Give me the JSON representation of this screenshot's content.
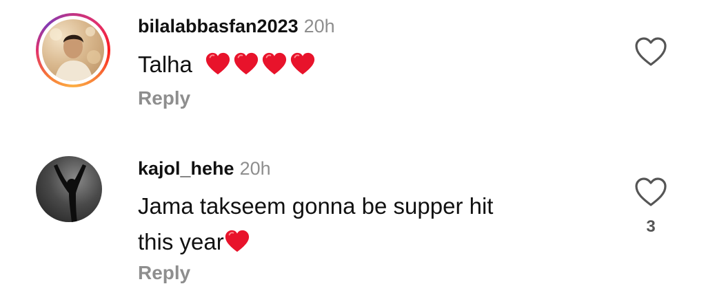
{
  "comments": [
    {
      "username": "bilalabbasfan2023",
      "time": "20h",
      "text": "Talha",
      "emoji_count": 4,
      "reply_label": "Reply",
      "like_count": "",
      "has_story_ring": true,
      "avatar_icon": "profile-photo"
    },
    {
      "username": "kajol_hehe",
      "time": "20h",
      "text_line1": "Jama takseem gonna be supper hit",
      "text_line2": "this year",
      "emoji_count": 1,
      "reply_label": "Reply",
      "like_count": "3",
      "has_story_ring": false,
      "avatar_icon": "silhouette-photo"
    }
  ],
  "colors": {
    "heart_emoji": "#e8132b",
    "secondary_text": "#8e8e8e",
    "primary_text": "#111111"
  },
  "icons": {
    "like": "heart-outline-icon",
    "emoji": "red-heart-emoji"
  }
}
